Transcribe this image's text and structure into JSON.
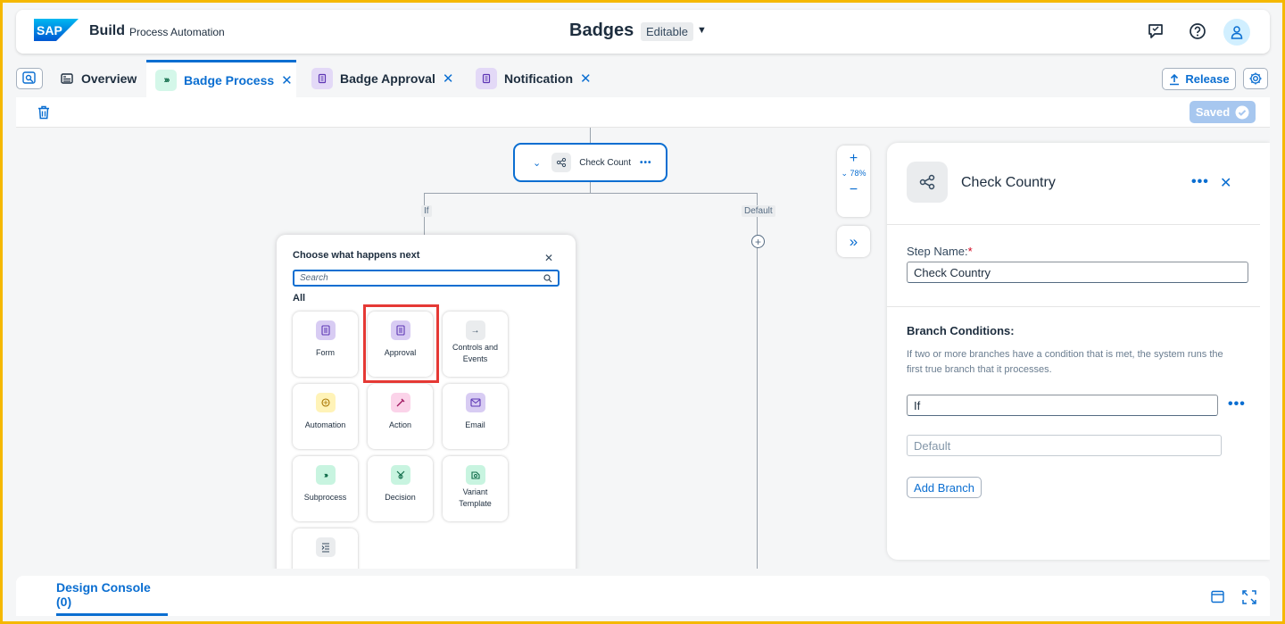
{
  "shell": {
    "logo_text": "SAP",
    "brand": "Build",
    "brand_sub": "Process Automation",
    "project_title": "Badges",
    "status_badge": "Editable"
  },
  "tabs": [
    {
      "label": "Overview",
      "icon": "overview-icon",
      "closable": false
    },
    {
      "label": "Badge Process",
      "icon": "process-icon",
      "closable": true,
      "active": true
    },
    {
      "label": "Badge Approval",
      "icon": "form-icon",
      "closable": true
    },
    {
      "label": "Notification",
      "icon": "form-icon",
      "closable": true
    }
  ],
  "toolbar": {
    "release_label": "Release",
    "saved_label": "Saved"
  },
  "canvas": {
    "node_label": "Check Count",
    "branch_if": "If",
    "branch_default": "Default",
    "zoom_level": "78%"
  },
  "popover": {
    "title": "Choose what happens next",
    "search_placeholder": "Search",
    "section": "All",
    "tiles": [
      {
        "label": "Form",
        "icon": "form-icon"
      },
      {
        "label": "Approval",
        "icon": "approval-icon"
      },
      {
        "label": "Controls and Events",
        "icon": "arrow-right-icon"
      },
      {
        "label": "Automation",
        "icon": "automation-icon"
      },
      {
        "label": "Action",
        "icon": "action-icon"
      },
      {
        "label": "Email",
        "icon": "email-icon"
      },
      {
        "label": "Subprocess",
        "icon": "subprocess-icon"
      },
      {
        "label": "Decision",
        "icon": "decision-icon"
      },
      {
        "label": "Variant Template",
        "icon": "variant-template-icon"
      },
      {
        "label": "",
        "icon": "list-icon"
      }
    ]
  },
  "panel": {
    "title": "Check Country",
    "step_name_label": "Step Name:",
    "step_name_value": "Check Country",
    "branch_conditions_label": "Branch Conditions:",
    "branch_hint": "If two or more branches have a condition that is met, the system runs the first true branch that it processes.",
    "branch_if_value": "If",
    "branch_default_placeholder": "Default",
    "add_branch_label": "Add Branch"
  },
  "console": {
    "tab_label": "Design Console (0)"
  },
  "colors": {
    "accent": "#0a6ed1",
    "frame": "#f5b800",
    "highlight": "#e53935"
  }
}
